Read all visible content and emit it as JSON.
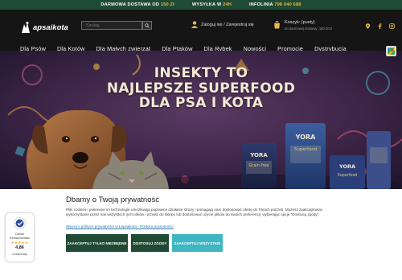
{
  "topbar": {
    "shipping_prefix": "DARMOWA DOSTAWA OD ",
    "shipping_value": "150 Zł",
    "dispatch_prefix": "WYSYŁKA W ",
    "dispatch_value": "24H",
    "hotline_prefix": "INFOLINIA ",
    "hotline_value": "798 040 688"
  },
  "header": {
    "logo_text": "apsaikota",
    "search_placeholder": "Szukaj",
    "login_label": "Zaloguj się / Zarejestruj się",
    "cart_label": "Koszyk: (pusty)",
    "cart_free_shipping": "do darmowej dostawy: 150.00zł",
    "social_icons": [
      "location-icon",
      "facebook-icon",
      "instagram-icon"
    ]
  },
  "nav": {
    "items": [
      {
        "label": "Dla Psów"
      },
      {
        "label": "Dla Kotów"
      },
      {
        "label": "Dla Małych zwierząt"
      },
      {
        "label": "Dla Ptaków"
      },
      {
        "label": "Dla Rybek"
      },
      {
        "label": "Nowości"
      },
      {
        "label": "Promocje"
      },
      {
        "label": "Dystrybucja"
      }
    ]
  },
  "hero": {
    "line1": "INSEKTY TO",
    "line2": "NAJLEPSZE SUPERFOOD",
    "line3": "DLA PSA I KOTA",
    "pack_brand": "YORA",
    "pack_a": "Grain-free",
    "pack_b": "Superfood",
    "pack_c": "Superfood"
  },
  "cookie": {
    "title": "Dbamy o Twoją prywatność",
    "body": "Pliki cookies i pokrewne im technologie umożliwiają poprawne działanie strony i pomagają nam dostosować ofertę do Twoich potrzeb. Możesz zaakceptować wykorzystanie przez nas wszystkich tych plików i przejść do sklepu lub dostosować użycie plików do swoich preferencji, wybierając opcję \"Dostosuj zgody\".",
    "link": "Więcej o polityce prywatności w Łapsaikota - Polityka prywatności",
    "btn_necessary": "Zaakceptuj tylko niezbędne",
    "btn_customize": "Dostosuj zgody",
    "btn_accept_all": "Zaakceptuj wszystkie"
  },
  "trust": {
    "label": "Opinie Konsumentów",
    "stars": "★★★★★",
    "score": "4,86",
    "verdict": "Doskonały"
  },
  "colors": {
    "brand_green": "#1f4a33",
    "accent_gold": "#e8b84a",
    "accept_all": "#3fb6c3",
    "header_bg": "#151515"
  }
}
